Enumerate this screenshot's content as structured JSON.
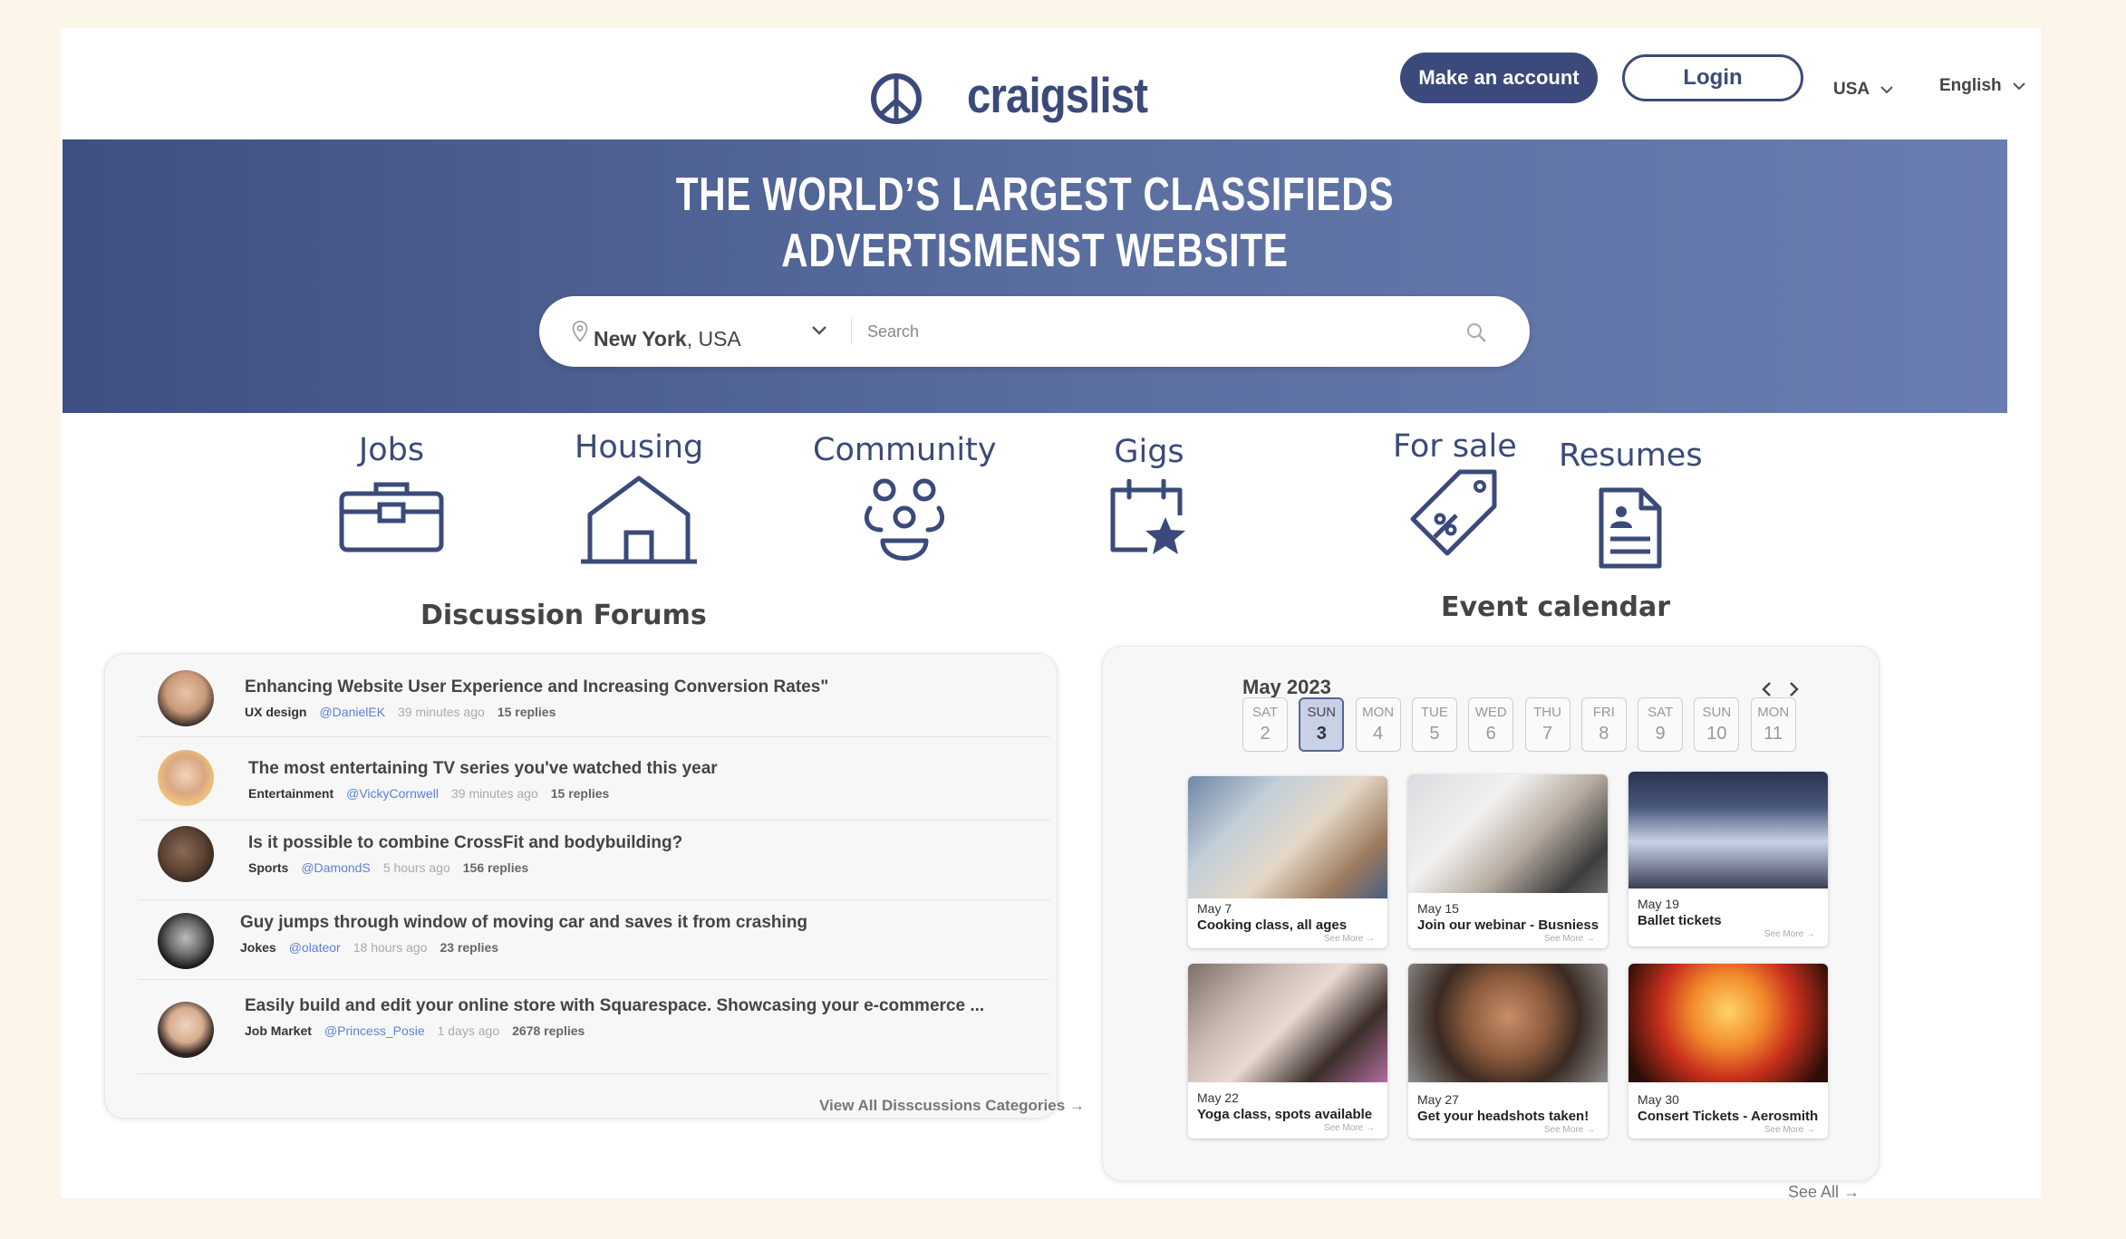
{
  "header": {
    "logo_text": "craigslist",
    "make_account_label": "Make an account",
    "login_label": "Login",
    "country": "USA",
    "language": "English"
  },
  "hero": {
    "title_line1": "THE WORLD’S LARGEST CLASSIFIEDS",
    "title_line2": "ADVERTISMENST WEBSITE",
    "location_city": "New York",
    "location_country": ", USA",
    "search_placeholder": "Search"
  },
  "categories": [
    {
      "label": "Jobs",
      "icon": "briefcase-icon"
    },
    {
      "label": "Housing",
      "icon": "house-icon"
    },
    {
      "label": "Community",
      "icon": "people-icon"
    },
    {
      "label": "Gigs",
      "icon": "calendar-star-icon"
    },
    {
      "label": "For sale",
      "icon": "price-tag-icon"
    },
    {
      "label": "Resumes",
      "icon": "resume-icon"
    }
  ],
  "forums": {
    "title": "Discussion Forums",
    "items": [
      {
        "title": "Enhancing Website User Experience and Increasing Conversion Rates\"",
        "category": "UX design",
        "user": "@DanielEK",
        "time": "39 minutes ago",
        "replies": "15 replies"
      },
      {
        "title": "The most entertaining TV series you've watched this year",
        "category": "Entertainment",
        "user": "@VickyCornwell",
        "time": "39 minutes ago",
        "replies": "15 replies"
      },
      {
        "title": "Is it possible to combine CrossFit and bodybuilding?",
        "category": "Sports",
        "user": "@DamondS",
        "time": "5 hours ago",
        "replies": "156 replies"
      },
      {
        "title": "Guy jumps through window of moving car and saves it from crashing",
        "category": "Jokes",
        "user": "@olateor",
        "time": "18 hours ago",
        "replies": "23 replies"
      },
      {
        "title": "Easily build and edit your online store with Squarespace. Showcasing your e-commerce ...",
        "category": "Job Market",
        "user": "@Princess_Posie",
        "time": "1 days ago",
        "replies": "2678 replies"
      }
    ],
    "view_all_label": "View All Disscussions Categories"
  },
  "events": {
    "title": "Event calendar",
    "month": "May 2023",
    "days": [
      {
        "name": "SAT",
        "num": "2"
      },
      {
        "name": "SUN",
        "num": "3"
      },
      {
        "name": "MON",
        "num": "4"
      },
      {
        "name": "TUE",
        "num": "5"
      },
      {
        "name": "WED",
        "num": "6"
      },
      {
        "name": "THU",
        "num": "7"
      },
      {
        "name": "FRI",
        "num": "8"
      },
      {
        "name": "SAT",
        "num": "9"
      },
      {
        "name": "SUN",
        "num": "10"
      },
      {
        "name": "MON",
        "num": "11"
      }
    ],
    "selected_day": "3",
    "cards": [
      {
        "date": "May 7",
        "title": "Cooking class, all ages",
        "more": "See More"
      },
      {
        "date": "May 15",
        "title": "Join our webinar - Busniess",
        "more": "See More"
      },
      {
        "date": "May 19",
        "title": "Ballet tickets",
        "more": "See More"
      },
      {
        "date": "May 22",
        "title": "Yoga class, spots available",
        "more": "See More"
      },
      {
        "date": "May 27",
        "title": "Get your headshots taken!",
        "more": "See More"
      },
      {
        "date": "May 30",
        "title": "Consert Tickets - Aerosmith",
        "more": "See More"
      }
    ],
    "see_all_label": "See All"
  },
  "colors": {
    "brand": "#3b4a7a",
    "hero_start": "#3e5081",
    "hero_end": "#6a7db0",
    "link": "#5b82d6",
    "background": "#fcf5ea"
  }
}
